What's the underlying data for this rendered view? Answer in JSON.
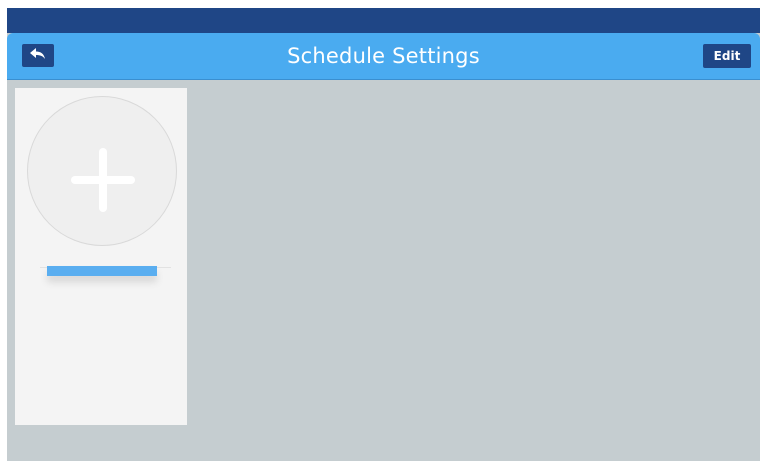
{
  "header": {
    "title": "Schedule Settings",
    "back_icon": "back-arrow-icon",
    "edit_label": "Edit"
  },
  "schedule_card": {
    "add_icon": "plus-icon",
    "label": ""
  },
  "colors": {
    "status_bar": "#1f4686",
    "title_bar": "#4aabf0",
    "button": "#1f4686",
    "background": "#c5cdd0",
    "card": "#f4f4f4",
    "accent_bar": "#5aaef0"
  }
}
